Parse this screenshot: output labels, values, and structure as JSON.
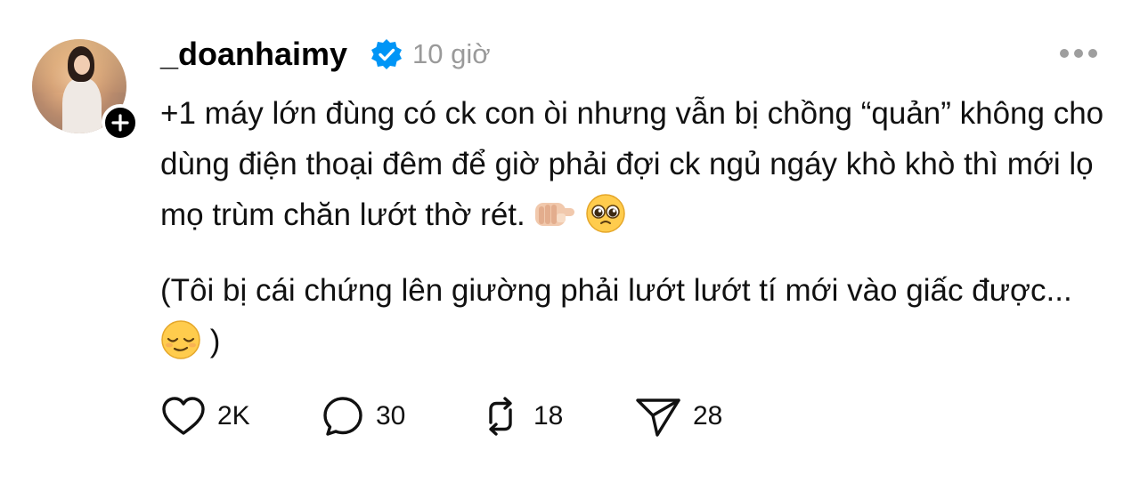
{
  "post": {
    "username": "_doanhaimy",
    "time": "10 giờ",
    "paragraph1": "+1 máy lớn đùng có ck con òi nhưng vẫn bị chồng “quản” không cho dùng điện thoại đêm để giờ phải đợi ck ngủ ngáy khò khò thì mới lọ mọ trùm chăn lướt thờ rét.",
    "paragraph2_start": "(Tôi bị cái chứng lên giường phải lướt lướt tí mới vào giấc được...",
    "paragraph2_end": ")"
  },
  "actions": {
    "likes": "2K",
    "comments": "30",
    "reposts": "18",
    "shares": "28"
  },
  "icons": {
    "verified": "verified-badge-icon",
    "more": "more-options-icon",
    "like": "heart-icon",
    "comment": "comment-bubble-icon",
    "repost": "repost-icon",
    "share": "send-icon",
    "add": "plus-icon"
  },
  "colors": {
    "verified": "#0095f6",
    "muted": "#9a9a9a"
  }
}
